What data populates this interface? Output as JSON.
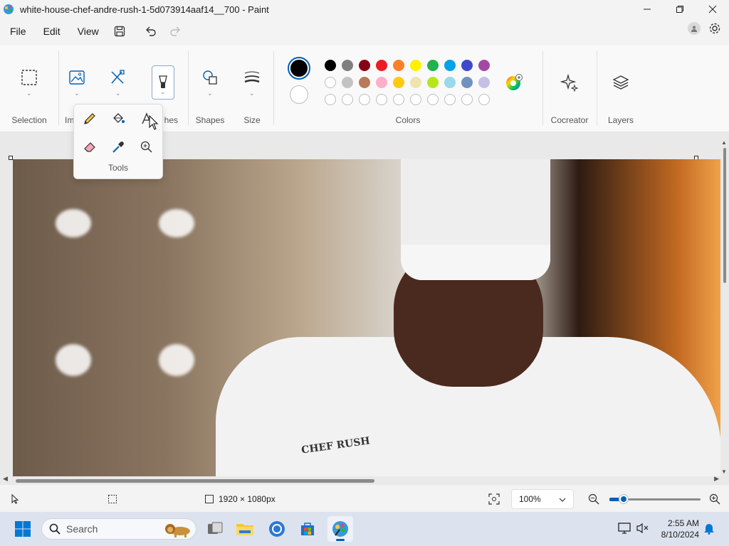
{
  "window": {
    "title": "white-house-chef-andre-rush-1-5d073914aaf14__700 - Paint",
    "minimize_icon": "minimize-icon",
    "maximize_icon": "restore-icon",
    "close_icon": "close-icon"
  },
  "menu": {
    "file": "File",
    "edit": "Edit",
    "view": "View"
  },
  "ribbon": {
    "selection_label": "Selection",
    "image_label": "Im",
    "brushes_label": "hes",
    "shapes_label": "Shapes",
    "size_label": "Size",
    "colors_label": "Colors",
    "cocreator_label": "Cocreator",
    "layers_label": "Layers",
    "primary_color": "#000000",
    "secondary_color": "#ffffff",
    "palette_row1": [
      "#000000",
      "#7f7f7f",
      "#880015",
      "#ed1c24",
      "#ff7f27",
      "#fff200",
      "#22b14c",
      "#00a2e8",
      "#3f48cc",
      "#a349a4"
    ],
    "palette_row2": [
      "#ffffff",
      "#c3c3c3",
      "#b97a57",
      "#ffaec9",
      "#ffc90e",
      "#efe4b0",
      "#b5e61d",
      "#99d9ea",
      "#7092be",
      "#c8bfe7"
    ]
  },
  "tools_popup": {
    "label": "Tools",
    "tools": [
      "pencil-icon",
      "fill-icon",
      "text-icon",
      "eraser-icon",
      "color-picker-icon",
      "magnifier-icon"
    ]
  },
  "canvas": {
    "coat_text": "CHEF RUSH"
  },
  "status": {
    "dimensions": "1920 × 1080px",
    "zoom": "100%"
  },
  "taskbar": {
    "search_placeholder": "Search",
    "time": "2:55 AM",
    "date": "8/10/2024"
  }
}
